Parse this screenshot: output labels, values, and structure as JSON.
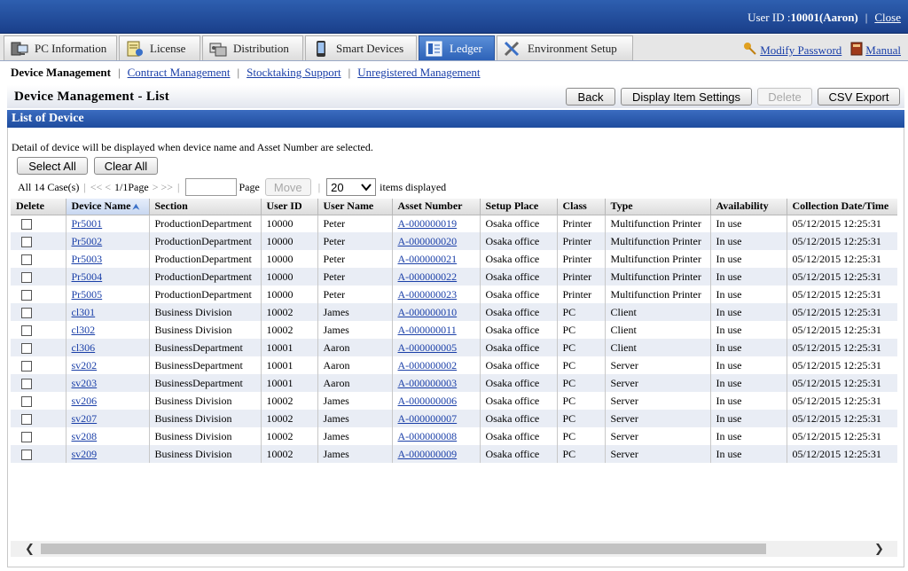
{
  "header": {
    "user_label": "User ID : ",
    "user_value": "10001(Aaron)",
    "close_label": "Close"
  },
  "tabs": [
    {
      "label": "PC Information",
      "icon": "pc-icon"
    },
    {
      "label": "License",
      "icon": "license-icon"
    },
    {
      "label": "Distribution",
      "icon": "distribution-icon"
    },
    {
      "label": "Smart Devices",
      "icon": "smartphone-icon"
    },
    {
      "label": "Ledger",
      "icon": "ledger-icon",
      "active": true
    },
    {
      "label": "Environment Setup",
      "icon": "tools-icon"
    }
  ],
  "right_links": {
    "modify_password": "Modify Password",
    "manual": "Manual"
  },
  "subnav": {
    "current": "Device Management",
    "links": [
      "Contract Management",
      "Stocktaking Support",
      "Unregistered Management"
    ]
  },
  "page": {
    "title": "Device Management - List",
    "buttons": {
      "back": "Back",
      "display_item_settings": "Display Item Settings",
      "delete": "Delete",
      "csv_export": "CSV Export"
    }
  },
  "section": {
    "title": "List of Device",
    "hint": "Detail of device will be displayed when device name and Asset Number are selected.",
    "select_all": "Select All",
    "clear_all": "Clear All"
  },
  "pager": {
    "total": "All 14 Case(s)",
    "first_prev": "<< <",
    "page_info": "1/1Page",
    "next_last": "> >>",
    "page_label": "Page",
    "move": "Move",
    "per_page": "20",
    "items_displayed": "items displayed"
  },
  "table": {
    "columns": [
      "Delete",
      "Device Name",
      "Section",
      "User ID",
      "User Name",
      "Asset Number",
      "Setup Place",
      "Class",
      "Type",
      "Availability",
      "Collection Date/Time"
    ],
    "rows": [
      [
        "Pr5001",
        "ProductionDepartment",
        "10000",
        "Peter",
        "A-000000019",
        "Osaka office",
        "Printer",
        "Multifunction Printer",
        "In use",
        "05/12/2015 12:25:31"
      ],
      [
        "Pr5002",
        "ProductionDepartment",
        "10000",
        "Peter",
        "A-000000020",
        "Osaka office",
        "Printer",
        "Multifunction Printer",
        "In use",
        "05/12/2015 12:25:31"
      ],
      [
        "Pr5003",
        "ProductionDepartment",
        "10000",
        "Peter",
        "A-000000021",
        "Osaka office",
        "Printer",
        "Multifunction Printer",
        "In use",
        "05/12/2015 12:25:31"
      ],
      [
        "Pr5004",
        "ProductionDepartment",
        "10000",
        "Peter",
        "A-000000022",
        "Osaka office",
        "Printer",
        "Multifunction Printer",
        "In use",
        "05/12/2015 12:25:31"
      ],
      [
        "Pr5005",
        "ProductionDepartment",
        "10000",
        "Peter",
        "A-000000023",
        "Osaka office",
        "Printer",
        "Multifunction Printer",
        "In use",
        "05/12/2015 12:25:31"
      ],
      [
        "cl301",
        "Business Division",
        "10002",
        "James",
        "A-000000010",
        "Osaka office",
        "PC",
        "Client",
        "In use",
        "05/12/2015 12:25:31"
      ],
      [
        "cl302",
        "Business Division",
        "10002",
        "James",
        "A-000000011",
        "Osaka office",
        "PC",
        "Client",
        "In use",
        "05/12/2015 12:25:31"
      ],
      [
        "cl306",
        "BusinessDepartment",
        "10001",
        "Aaron",
        "A-000000005",
        "Osaka office",
        "PC",
        "Client",
        "In use",
        "05/12/2015 12:25:31"
      ],
      [
        "sv202",
        "BusinessDepartment",
        "10001",
        "Aaron",
        "A-000000002",
        "Osaka office",
        "PC",
        "Server",
        "In use",
        "05/12/2015 12:25:31"
      ],
      [
        "sv203",
        "BusinessDepartment",
        "10001",
        "Aaron",
        "A-000000003",
        "Osaka office",
        "PC",
        "Server",
        "In use",
        "05/12/2015 12:25:31"
      ],
      [
        "sv206",
        "Business Division",
        "10002",
        "James",
        "A-000000006",
        "Osaka office",
        "PC",
        "Server",
        "In use",
        "05/12/2015 12:25:31"
      ],
      [
        "sv207",
        "Business Division",
        "10002",
        "James",
        "A-000000007",
        "Osaka office",
        "PC",
        "Server",
        "In use",
        "05/12/2015 12:25:31"
      ],
      [
        "sv208",
        "Business Division",
        "10002",
        "James",
        "A-000000008",
        "Osaka office",
        "PC",
        "Server",
        "In use",
        "05/12/2015 12:25:31"
      ],
      [
        "sv209",
        "Business Division",
        "10002",
        "James",
        "A-000000009",
        "Osaka office",
        "PC",
        "Server",
        "In use",
        "05/12/2015 12:25:31"
      ]
    ]
  },
  "colors": {
    "header_blue": "#1f4c9e",
    "link": "#1a3fa8",
    "row_alt": "#e9edf5"
  }
}
